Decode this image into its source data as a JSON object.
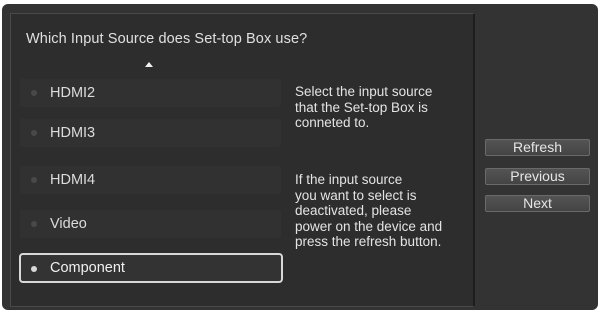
{
  "dialog": {
    "question": "Which Input Source does Set-top Box use?"
  },
  "sources": [
    {
      "label": "HDMI2",
      "selected": false
    },
    {
      "label": "HDMI3",
      "selected": false
    },
    {
      "label": "HDMI4",
      "selected": false
    },
    {
      "label": "Video",
      "selected": false
    },
    {
      "label": "Component",
      "selected": true
    }
  ],
  "help": {
    "select_text": "Select the input source\nthat the Set-top Box is\nconneted to.",
    "deactivated_text": "If the input source\nyou want to select is\ndeactivated, please\npower on the device and\npress the refresh button."
  },
  "buttons": {
    "refresh": "Refresh",
    "previous": "Previous",
    "next": "Next"
  },
  "icons": {
    "scroll_up": "chevron-up-icon",
    "bullet": "bullet-dot-icon"
  },
  "colors": {
    "panel_bg": "#333333",
    "selected_border": "#d8d8d8"
  }
}
